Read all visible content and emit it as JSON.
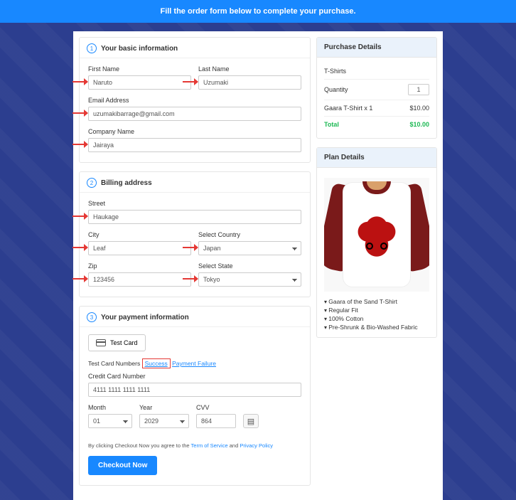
{
  "banner": "Fill the order form below to complete your purchase.",
  "section1": {
    "title": "Your basic information",
    "num": "1",
    "first_label": "First Name",
    "first_value": "Naruto",
    "last_label": "Last Name",
    "last_value": "Uzumaki",
    "email_label": "Email Address",
    "email_value": "uzumakibarrage@gmail.com",
    "company_label": "Company Name",
    "company_value": "Jairaya"
  },
  "section2": {
    "title": "Billing address",
    "num": "2",
    "street_label": "Street",
    "street_value": "Haukage",
    "city_label": "City",
    "city_value": "Leaf",
    "country_label": "Select Country",
    "country_value": "Japan",
    "zip_label": "Zip",
    "zip_value": "123456",
    "state_label": "Select State",
    "state_value": "Tokyo"
  },
  "section3": {
    "title": "Your payment information",
    "num": "3",
    "testcard_btn": "Test Card",
    "tcn_prefix": "Test Card Numbers ",
    "success": "Success",
    "failure": "Payment Failure",
    "cc_label": "Credit Card Number",
    "cc_value": "4111 1111 1111 1111",
    "month_label": "Month",
    "month_value": "01",
    "year_label": "Year",
    "year_value": "2029",
    "cvv_label": "CVV",
    "cvv_value": "864",
    "agree_pre": "By clicking Checkout Now you agree to the ",
    "tos": "Term of Service",
    "and": " and ",
    "pp": "Privacy Policy",
    "checkout": "Checkout Now"
  },
  "purchase": {
    "head": "Purchase Details",
    "item": "T-Shirts",
    "qty_label": "Quantity",
    "qty_value": "1",
    "line_label": "Gaara T-Shirt x 1",
    "line_price": "$10.00",
    "total_label": "Total",
    "total_price": "$10.00"
  },
  "plan": {
    "head": "Plan Details",
    "bullets": [
      "Gaara of the Sand T-Shirt",
      "Regular Fit",
      "100% Cotton",
      "Pre-Shrunk & Bio-Washed Fabric"
    ]
  }
}
